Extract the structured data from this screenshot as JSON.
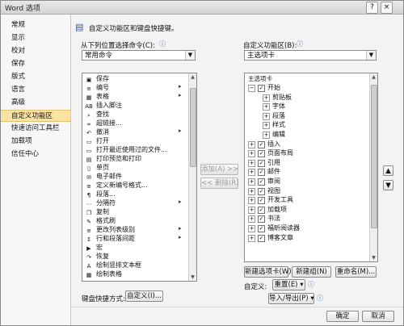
{
  "window": {
    "title": "Word 选项",
    "help_icon": "?",
    "close_icon": "×"
  },
  "nav": [
    "常规",
    "显示",
    "校对",
    "保存",
    "版式",
    "语言",
    "高级",
    "自定义功能区",
    "快速访问工具栏",
    "加载项",
    "信任中心"
  ],
  "nav_selected": 7,
  "header": {
    "description": "自定义功能区和键盘快捷键。"
  },
  "left_panel": {
    "label": "从下列位置选择命令(C):",
    "combo_value": "常用命令",
    "commands": [
      {
        "icon": "save-icon",
        "glyph": "▣",
        "label": "保存",
        "submenu": false
      },
      {
        "icon": "numbering-icon",
        "glyph": "≡",
        "label": "编号",
        "submenu": true
      },
      {
        "icon": "table-icon",
        "glyph": "▦",
        "label": "表格",
        "submenu": true
      },
      {
        "icon": "footnote-icon",
        "glyph": "AB",
        "label": "插入脚注",
        "submenu": false
      },
      {
        "icon": "find-icon",
        "glyph": "⌕",
        "label": "查找",
        "submenu": false
      },
      {
        "icon": "hyperlink-icon",
        "glyph": "∞",
        "label": "超链接...",
        "submenu": false
      },
      {
        "icon": "undo-icon",
        "glyph": "↶",
        "label": "撤消",
        "submenu": true
      },
      {
        "icon": "open-icon",
        "glyph": "▭",
        "label": "打开",
        "submenu": false
      },
      {
        "icon": "recent-file-icon",
        "glyph": "▭",
        "label": "打开最近使用过的文件...",
        "submenu": false
      },
      {
        "icon": "print-preview-icon",
        "glyph": "▤",
        "label": "打印预览和打印",
        "submenu": false
      },
      {
        "icon": "single-page-icon",
        "glyph": "▯",
        "label": "单页",
        "submenu": false
      },
      {
        "icon": "email-icon",
        "glyph": "✉",
        "label": "电子邮件",
        "submenu": false
      },
      {
        "icon": "numbering-format-icon",
        "glyph": "≡",
        "label": "定义新编号格式...",
        "submenu": false
      },
      {
        "icon": "paragraph-icon",
        "glyph": "¶",
        "label": "段落...",
        "submenu": false
      },
      {
        "icon": "separator-icon",
        "glyph": "⋯",
        "label": "分隔符",
        "submenu": true
      },
      {
        "icon": "copy-icon",
        "glyph": "❐",
        "label": "复制",
        "submenu": false
      },
      {
        "icon": "format-painter-icon",
        "glyph": "✎",
        "label": "格式刷",
        "submenu": false
      },
      {
        "icon": "list-level-icon",
        "glyph": "≡",
        "label": "更改列表级别",
        "submenu": true
      },
      {
        "icon": "line-spacing-icon",
        "glyph": "↕",
        "label": "行和段落间距",
        "submenu": true
      },
      {
        "icon": "macro-icon",
        "glyph": "▶",
        "label": "宏",
        "submenu": false
      },
      {
        "icon": "redo-icon",
        "glyph": "↷",
        "label": "恢复",
        "submenu": false
      },
      {
        "icon": "draw-textbox-icon",
        "glyph": "A",
        "label": "绘制竖排文本框",
        "submenu": false
      },
      {
        "icon": "draw-table-icon",
        "glyph": "▦",
        "label": "绘制表格",
        "submenu": false
      }
    ]
  },
  "middle": {
    "add_label": "添加(A) >>",
    "remove_label": "<< 删除(R)"
  },
  "right_panel": {
    "label": "自定义功能区(B):",
    "combo_value": "主选项卡",
    "tree_header": "主选项卡",
    "tree": [
      {
        "level": 0,
        "expander": "⊟",
        "checked": true,
        "label": "开始"
      },
      {
        "level": 1,
        "expander": "⊞",
        "label": "剪贴板"
      },
      {
        "level": 1,
        "expander": "⊞",
        "label": "字体"
      },
      {
        "level": 1,
        "expander": "⊞",
        "label": "段落"
      },
      {
        "level": 1,
        "expander": "⊞",
        "label": "样式"
      },
      {
        "level": 1,
        "expander": "⊞",
        "label": "编辑"
      },
      {
        "level": 0,
        "expander": "⊞",
        "checked": true,
        "label": "插入"
      },
      {
        "level": 0,
        "expander": "⊞",
        "checked": true,
        "label": "页面布局"
      },
      {
        "level": 0,
        "expander": "⊞",
        "checked": true,
        "label": "引用"
      },
      {
        "level": 0,
        "expander": "⊞",
        "checked": true,
        "label": "邮件"
      },
      {
        "level": 0,
        "expander": "⊞",
        "checked": true,
        "label": "审阅"
      },
      {
        "level": 0,
        "expander": "⊞",
        "checked": true,
        "label": "视图"
      },
      {
        "level": 0,
        "expander": "⊞",
        "checked": true,
        "label": "开发工具"
      },
      {
        "level": 0,
        "expander": "⊞",
        "checked": true,
        "label": "加载项"
      },
      {
        "level": 0,
        "expander": "⊞",
        "checked": true,
        "label": "书法"
      },
      {
        "level": 0,
        "expander": "⊞",
        "checked": true,
        "label": "福昕阅读器"
      },
      {
        "level": 0,
        "expander": "⊞",
        "checked": true,
        "label": "博客文章"
      }
    ],
    "new_tab": "新建选项卡(W)",
    "new_group": "新建组(N)",
    "rename": "重命名(M)...",
    "custom_label": "自定义:",
    "reset": "重置(E) ▾",
    "import_export": "导入/导出(P) ▾"
  },
  "shortcut": {
    "label": "键盘快捷方式:",
    "button": "自定义(I)..."
  },
  "footer": {
    "ok": "确定",
    "cancel": "取消"
  },
  "colors": {
    "selection": "#fbe3a4"
  }
}
